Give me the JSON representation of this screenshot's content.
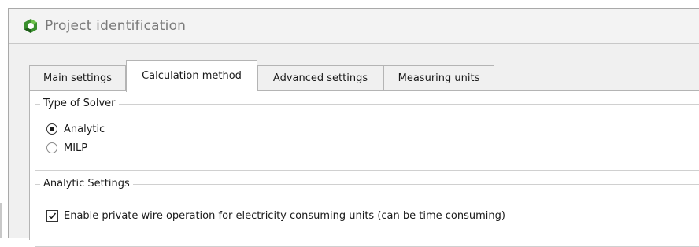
{
  "window": {
    "title": "Project identification",
    "logo_icon": "project-logo-icon",
    "accent": "#2e7d32"
  },
  "tabs": [
    {
      "label": "Main settings",
      "active": false
    },
    {
      "label": "Calculation method",
      "active": true
    },
    {
      "label": "Advanced settings",
      "active": false
    },
    {
      "label": "Measuring units",
      "active": false
    }
  ],
  "solver": {
    "legend": "Type of Solver",
    "options": [
      {
        "label": "Analytic",
        "selected": true
      },
      {
        "label": "MILP",
        "selected": false
      }
    ]
  },
  "analytic": {
    "legend": "Analytic Settings",
    "private_wire": {
      "label": "Enable private wire operation for electricity consuming units (can be time consuming)",
      "checked": true
    }
  }
}
